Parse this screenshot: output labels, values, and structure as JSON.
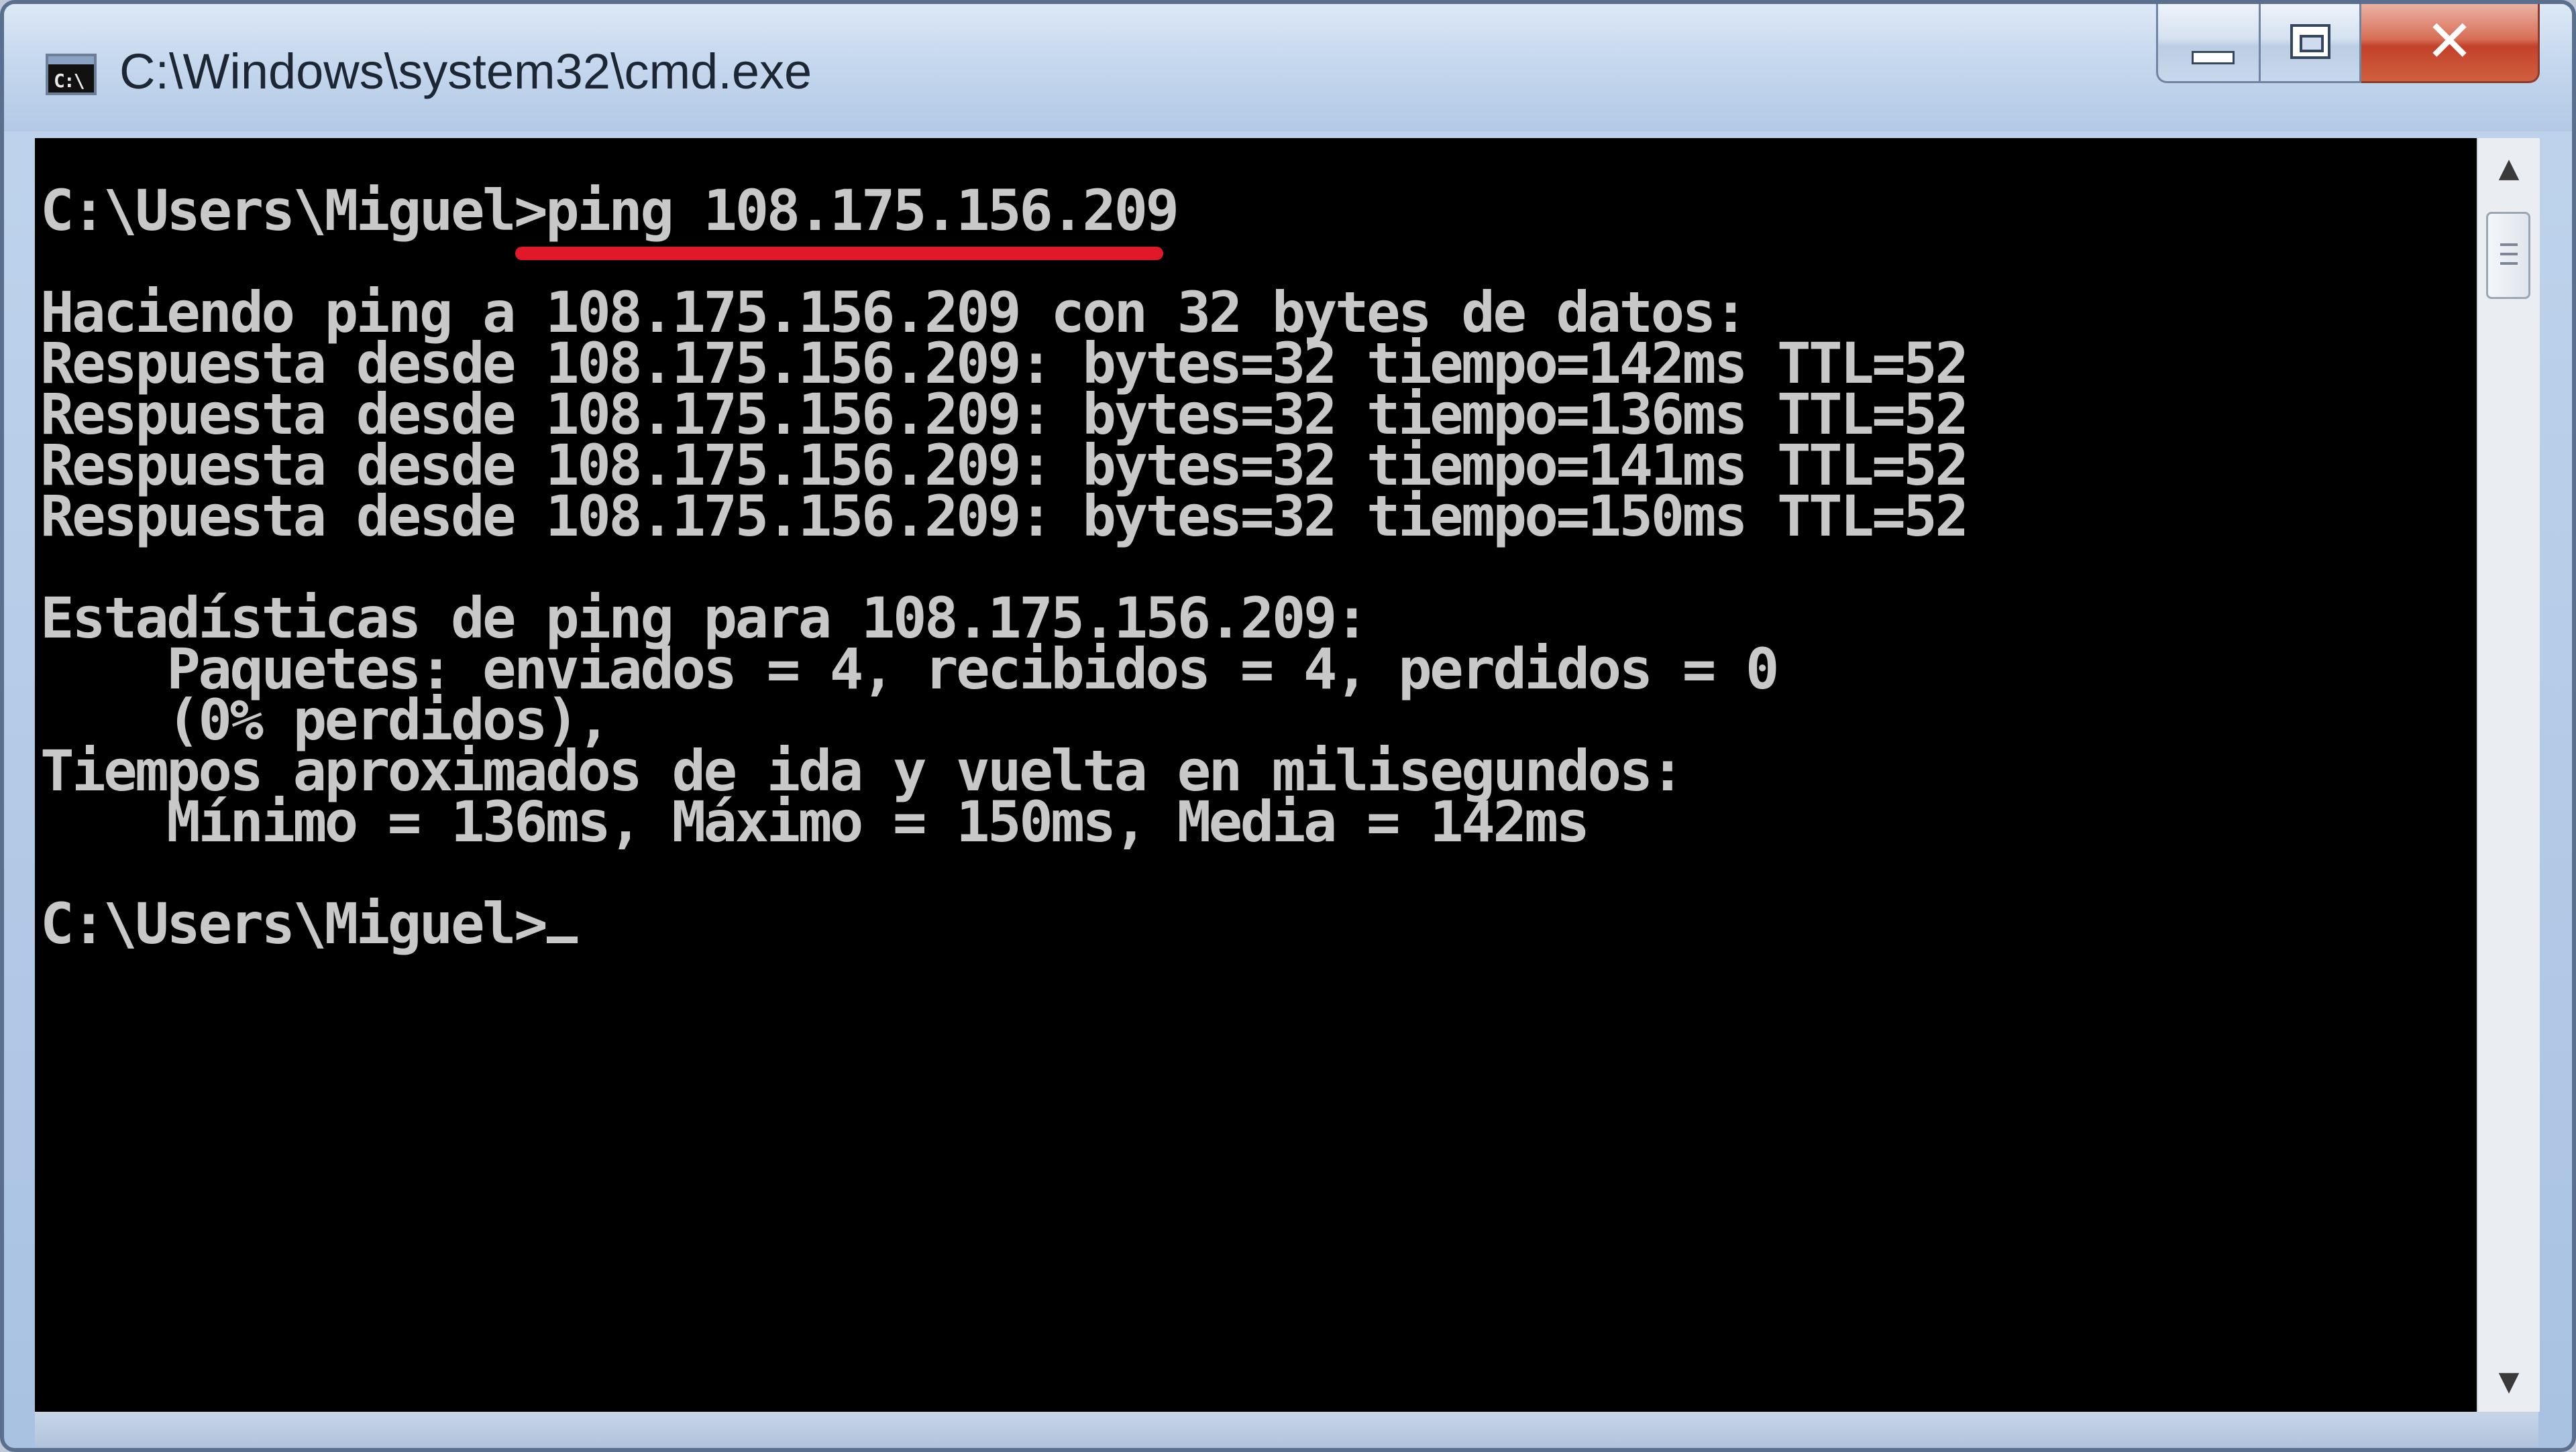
{
  "window": {
    "title": "C:\\Windows\\system32\\cmd.exe",
    "icon": "cmd-icon",
    "icon_label": "C:\\",
    "buttons": {
      "minimize": "minimize-icon",
      "maximize": "maximize-icon",
      "close": "close-icon",
      "close_glyph": "✕"
    }
  },
  "console": {
    "lines": [
      "C:\\Users\\Miguel>ping 108.175.156.209",
      "",
      "Haciendo ping a 108.175.156.209 con 32 bytes de datos:",
      "Respuesta desde 108.175.156.209: bytes=32 tiempo=142ms TTL=52",
      "Respuesta desde 108.175.156.209: bytes=32 tiempo=136ms TTL=52",
      "Respuesta desde 108.175.156.209: bytes=32 tiempo=141ms TTL=52",
      "Respuesta desde 108.175.156.209: bytes=32 tiempo=150ms TTL=52",
      "",
      "Estadísticas de ping para 108.175.156.209:",
      "    Paquetes: enviados = 4, recibidos = 4, perdidos = 0",
      "    (0% perdidos),",
      "Tiempos aproximados de ida y vuelta en milisegundos:",
      "    Mínimo = 136ms, Máximo = 150ms, Media = 142ms",
      ""
    ],
    "prompt": "C:\\Users\\Miguel>",
    "highlight_color": "#e0182a",
    "text_color": "#c8c8c8",
    "background_color": "#000000"
  },
  "scrollbar": {
    "up_arrow": "▲",
    "down_arrow": "▼"
  }
}
